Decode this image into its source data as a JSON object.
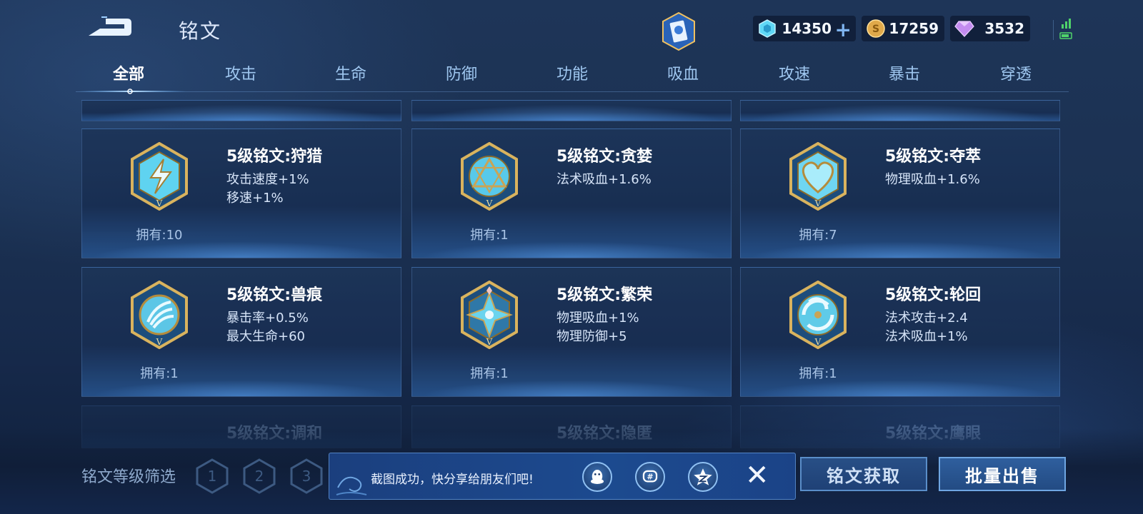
{
  "header": {
    "title": "铭文",
    "currencies": [
      {
        "icon": "crystal-icon",
        "value": "14350"
      },
      {
        "icon": "gold-coin-icon",
        "value": "17259"
      },
      {
        "icon": "diamond-icon",
        "value": "3532"
      }
    ]
  },
  "tabs": [
    {
      "label": "全部",
      "active": true
    },
    {
      "label": "攻击"
    },
    {
      "label": "生命"
    },
    {
      "label": "防御"
    },
    {
      "label": "功能"
    },
    {
      "label": "吸血"
    },
    {
      "label": "攻速"
    },
    {
      "label": "暴击"
    },
    {
      "label": "穿透"
    }
  ],
  "runes": [
    {
      "name": "5级铭文:狩猎",
      "stats": [
        "攻击速度+1%",
        "移速+1%"
      ],
      "owned": "拥有:10",
      "icon": "lightning-rune-icon",
      "color": "#5fd3f0"
    },
    {
      "name": "5级铭文:贪婪",
      "stats": [
        "法术吸血+1.6%"
      ],
      "owned": "拥有:1",
      "icon": "triangle-rune-icon",
      "color": "#58c9ea"
    },
    {
      "name": "5级铭文:夺萃",
      "stats": [
        "物理吸血+1.6%"
      ],
      "owned": "拥有:7",
      "icon": "heart-rune-icon",
      "color": "#6fd6f2"
    },
    {
      "name": "5级铭文:兽痕",
      "stats": [
        "暴击率+0.5%",
        "最大生命+60"
      ],
      "owned": "拥有:1",
      "icon": "claw-rune-icon",
      "color": "#5cc6e6"
    },
    {
      "name": "5级铭文:繁荣",
      "stats": [
        "物理吸血+1%",
        "物理防御+5"
      ],
      "owned": "拥有:1",
      "icon": "star-rune-icon",
      "color": "#6ad4ee"
    },
    {
      "name": "5级铭文:轮回",
      "stats": [
        "法术攻击+2.4",
        "法术吸血+1%"
      ],
      "owned": "拥有:1",
      "icon": "swirl-rune-icon",
      "color": "#5fcbe8"
    }
  ],
  "partial_runes": [
    {
      "name": "5级铭文:调和"
    },
    {
      "name": "5级铭文:隐匿"
    },
    {
      "name": "5级铭文:鹰眼"
    }
  ],
  "bottom": {
    "filter_label": "铭文等级筛选",
    "levels": [
      "1",
      "2",
      "3"
    ],
    "toast_text": "截图成功，快分享给朋友们吧!",
    "share_icons": [
      "qq-icon",
      "wechat-moments-icon",
      "qzone-icon"
    ],
    "get_runes_label": "铭文获取",
    "bulk_sell_label": "批量出售"
  }
}
